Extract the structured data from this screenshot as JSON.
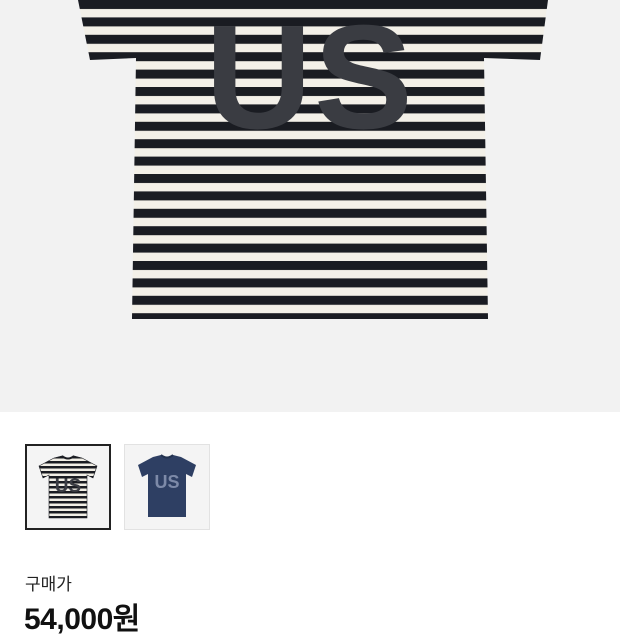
{
  "product": {
    "print_text": "US",
    "main_image_icon": "striped-tshirt-image"
  },
  "thumbnails": [
    {
      "name": "striped",
      "print_text": "US",
      "shirt_color": "#f2efe6",
      "stripe_color": "#1a1c22",
      "print_color": "#3b3d44",
      "selected": true
    },
    {
      "name": "navy",
      "print_text": "US",
      "shirt_color": "#2e3f63",
      "stripe_color": "",
      "print_color": "#7d8aa8",
      "selected": false
    }
  ],
  "price": {
    "label": "구매가",
    "value": "54,000원"
  },
  "colors": {
    "stripe_dark": "#1a1c22",
    "stripe_light": "#f3f0e8",
    "print": "#3a3c42",
    "hero_bg": "#f2f2f2"
  }
}
